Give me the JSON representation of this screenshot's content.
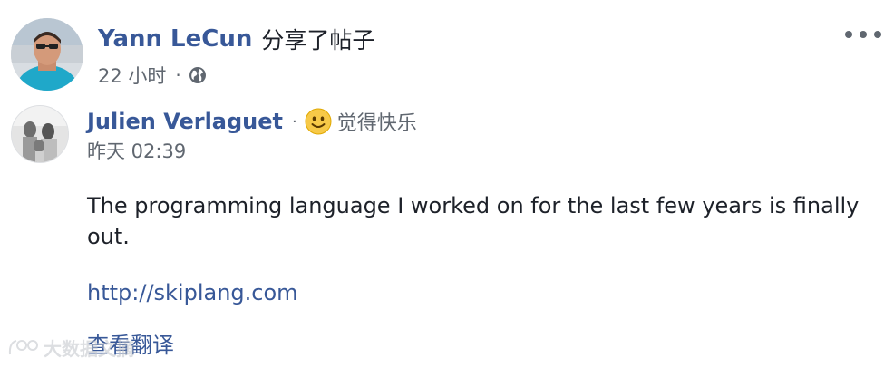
{
  "post": {
    "author": "Yann LeCun",
    "action": "分享了帖子",
    "time": "22 小时",
    "separator": "·",
    "privacy_icon": "globe-icon",
    "more_icon": "more-options-icon"
  },
  "shared_post": {
    "author": "Julien Verlaguet",
    "separator": "·",
    "feeling_icon": "smile-emoji-icon",
    "feeling": "觉得快乐",
    "time": "昨天 02:39",
    "body": "The programming language I worked on for the last few years is finally out.",
    "link": "http://skiplang.com",
    "see_translation": "查看翻译"
  },
  "watermark": {
    "text": "大数据文摘"
  },
  "colors": {
    "link": "#385898",
    "text": "#1d2129",
    "meta": "#606770"
  }
}
